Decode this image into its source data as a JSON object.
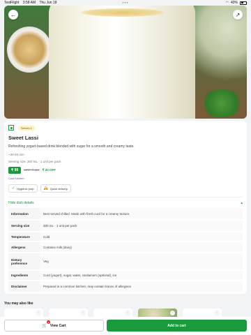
{
  "status_bar": {
    "app": "TestFlight",
    "time": "3:58 AM",
    "date": "Thu Jun 18",
    "battery": "40%"
  },
  "product": {
    "serves": "Serves 1",
    "title": "Sweet Lassi",
    "description": "Refreshing yogurt-based drink blended with sugar for a smooth and creamy taste.",
    "time": "~30-40 min",
    "serving_size": "Serving size: 300 mL · 1 unit per pack",
    "price": "₹ 99",
    "mrp": "MRP ₹ 119",
    "discount": "₹ 20 OFF",
    "kitchen": "Cold Kitchen",
    "chips": [
      {
        "label": "Hygienic prep",
        "icon": "check-icon"
      },
      {
        "label": "Quick delivery",
        "icon": "scooter-icon"
      }
    ],
    "hide_details_label": "Hide dish details",
    "details": [
      {
        "key": "Information",
        "value": "Best served chilled. Made with fresh curd for a creamy texture."
      },
      {
        "key": "Serving size",
        "value": "300 mL · 1 unit per pack"
      },
      {
        "key": "Temperature",
        "value": "Cold"
      },
      {
        "key": "Allergens",
        "value": "Contains milk (dairy)"
      },
      {
        "key": "Dietary preference",
        "value": "Veg"
      },
      {
        "key": "Ingredients",
        "value": "Curd (yogurt), sugar, water, cardamom (optional), ice"
      },
      {
        "key": "Disclaimer",
        "value": "Prepared in a common kitchen; may contain traces of allergens"
      }
    ]
  },
  "suggestions": {
    "title": "You may also like"
  },
  "bottom": {
    "view_cart": "View Cart",
    "cart_count": "1",
    "add_to_cart": "Add to cart"
  },
  "colors": {
    "accent": "#1a9a3c",
    "kitchen": "#6a3fc9",
    "badge": "#e2262b"
  }
}
